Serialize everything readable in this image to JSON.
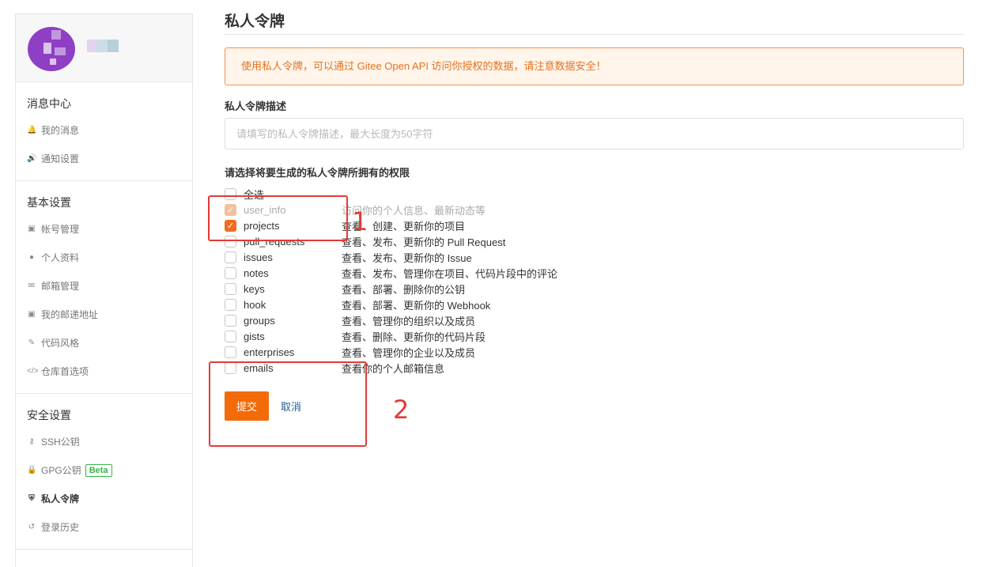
{
  "sidebar": {
    "sections": [
      {
        "title": "消息中心",
        "items": [
          {
            "icon": "bell-icon",
            "glyph": "🔔",
            "label": "我的消息"
          },
          {
            "icon": "speaker-icon",
            "glyph": "🔊",
            "label": "通知设置"
          }
        ]
      },
      {
        "title": "基本设置",
        "items": [
          {
            "icon": "id-card-icon",
            "glyph": "▣",
            "label": "帐号管理"
          },
          {
            "icon": "user-icon",
            "glyph": "●",
            "label": "个人资料"
          },
          {
            "icon": "envelope-icon",
            "glyph": "✉",
            "label": "邮箱管理"
          },
          {
            "icon": "address-card-icon",
            "glyph": "▣",
            "label": "我的邮递地址"
          },
          {
            "icon": "brush-icon",
            "glyph": "✎",
            "label": "代码风格"
          },
          {
            "icon": "code-icon",
            "glyph": "</>",
            "label": "仓库首选项"
          }
        ]
      },
      {
        "title": "安全设置",
        "items": [
          {
            "icon": "key-icon",
            "glyph": "⚷",
            "label": "SSH公钥"
          },
          {
            "icon": "lock-icon",
            "glyph": "🔒",
            "label": "GPG公钥",
            "badge": "Beta"
          },
          {
            "icon": "agent-icon",
            "glyph": "⛨",
            "label": "私人令牌",
            "active": true
          },
          {
            "icon": "history-icon",
            "glyph": "↺",
            "label": "登录历史"
          }
        ]
      }
    ]
  },
  "main": {
    "title": "私人令牌",
    "notice": "使用私人令牌，可以通过 Gitee Open API 访问你授权的数据，请注意数据安全！",
    "desc_label": "私人令牌描述",
    "desc_placeholder": "请填写的私人令牌描述，最大长度为50字符",
    "perm_label": "请选择将要生成的私人令牌所拥有的权限",
    "select_all": "全选",
    "permissions": [
      {
        "name": "user_info",
        "desc": "访问你的个人信息、最新动态等",
        "checked": true,
        "disabled": true
      },
      {
        "name": "projects",
        "desc": "查看、创建、更新你的项目",
        "checked": true,
        "disabled": false
      },
      {
        "name": "pull_requests",
        "desc": "查看、发布、更新你的 Pull Request",
        "checked": false,
        "disabled": false
      },
      {
        "name": "issues",
        "desc": "查看、发布、更新你的 Issue",
        "checked": false,
        "disabled": false
      },
      {
        "name": "notes",
        "desc": "查看、发布、管理你在项目、代码片段中的评论",
        "checked": false,
        "disabled": false
      },
      {
        "name": "keys",
        "desc": "查看、部署、删除你的公钥",
        "checked": false,
        "disabled": false
      },
      {
        "name": "hook",
        "desc": "查看、部署、更新你的 Webhook",
        "checked": false,
        "disabled": false
      },
      {
        "name": "groups",
        "desc": "查看、管理你的组织以及成员",
        "checked": false,
        "disabled": false
      },
      {
        "name": "gists",
        "desc": "查看、删除、更新你的代码片段",
        "checked": false,
        "disabled": false
      },
      {
        "name": "enterprises",
        "desc": "查看、管理你的企业以及成员",
        "checked": false,
        "disabled": false
      },
      {
        "name": "emails",
        "desc": "查看你的个人邮箱信息",
        "checked": false,
        "disabled": false
      }
    ],
    "submit_label": "提交",
    "cancel_label": "取消"
  },
  "annotations": {
    "one": "1",
    "two": "2"
  },
  "colors": {
    "accent": "#f26b08",
    "annotation": "#e53935",
    "notice_border": "#f2924b",
    "link": "#1d5e9a"
  }
}
